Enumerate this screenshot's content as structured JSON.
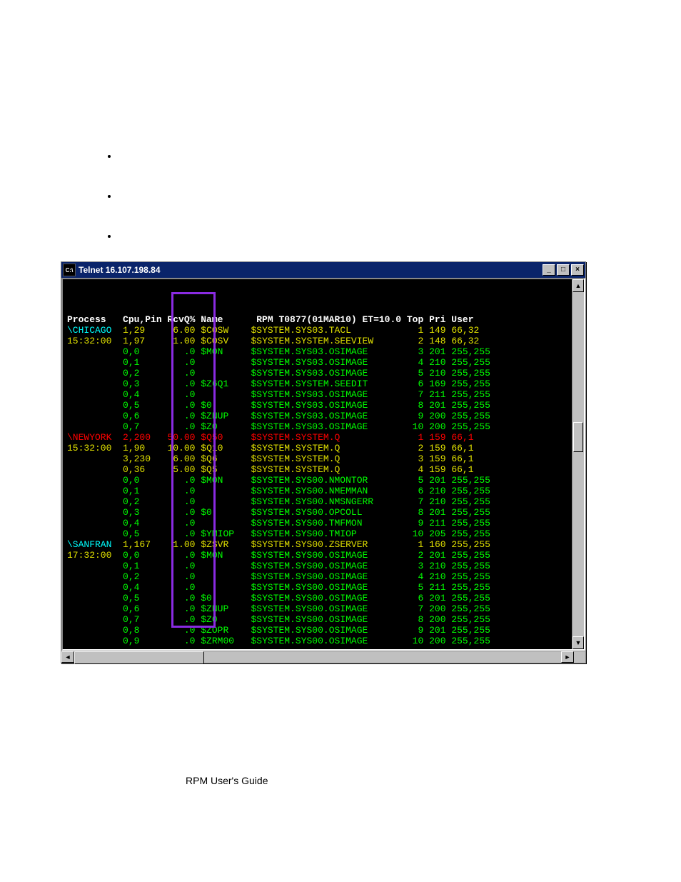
{
  "titlebar": {
    "icon_label": "C:\\",
    "title": "Telnet 16.107.198.84",
    "min_label": "_",
    "max_label": "□",
    "close_label": "×"
  },
  "header": {
    "process": "Process",
    "cpupin": "Cpu,Pin",
    "rcvq": "RcvQ%",
    "name": "Name",
    "right": "RPM T0877(01MAR10) ET=10.0 Top Pri User"
  },
  "nodes": [
    {
      "node": "\\CHICAGO",
      "time": "15:32:00",
      "node_cls": "cyan",
      "time_cls": "yel",
      "rows": [
        {
          "cpu": "1,29",
          "rcv": "6.00",
          "nm": "$COSW",
          "prog": "$SYSTEM.SYS03.TACL",
          "top": "1",
          "pri": "149",
          "user": "66,32",
          "cls": "yel"
        },
        {
          "cpu": "1,97",
          "rcv": "1.00",
          "nm": "$COSV",
          "prog": "$SYSTEM.SYSTEM.SEEVIEW",
          "top": "2",
          "pri": "148",
          "user": "66,32",
          "cls": "yel"
        },
        {
          "cpu": "0,0",
          "rcv": ".0",
          "nm": "$MON",
          "prog": "$SYSTEM.SYS03.OSIMAGE",
          "top": "3",
          "pri": "201",
          "user": "255,255",
          "cls": "grn"
        },
        {
          "cpu": "0,1",
          "rcv": ".0",
          "nm": "",
          "prog": "$SYSTEM.SYS03.OSIMAGE",
          "top": "4",
          "pri": "210",
          "user": "255,255",
          "cls": "grn"
        },
        {
          "cpu": "0,2",
          "rcv": ".0",
          "nm": "",
          "prog": "$SYSTEM.SYS03.OSIMAGE",
          "top": "5",
          "pri": "210",
          "user": "255,255",
          "cls": "grn"
        },
        {
          "cpu": "0,3",
          "rcv": ".0",
          "nm": "$Z6Q1",
          "prog": "$SYSTEM.SYSTEM.SEEDIT",
          "top": "6",
          "pri": "169",
          "user": "255,255",
          "cls": "grn"
        },
        {
          "cpu": "0,4",
          "rcv": ".0",
          "nm": "",
          "prog": "$SYSTEM.SYS03.OSIMAGE",
          "top": "7",
          "pri": "211",
          "user": "255,255",
          "cls": "grn"
        },
        {
          "cpu": "0,5",
          "rcv": ".0",
          "nm": "$0",
          "prog": "$SYSTEM.SYS03.OSIMAGE",
          "top": "8",
          "pri": "201",
          "user": "255,255",
          "cls": "grn"
        },
        {
          "cpu": "0,6",
          "rcv": ".0",
          "nm": "$ZNUP",
          "prog": "$SYSTEM.SYS03.OSIMAGE",
          "top": "9",
          "pri": "200",
          "user": "255,255",
          "cls": "grn"
        },
        {
          "cpu": "0,7",
          "rcv": ".0",
          "nm": "$Z0",
          "prog": "$SYSTEM.SYS03.OSIMAGE",
          "top": "10",
          "pri": "200",
          "user": "255,255",
          "cls": "grn"
        }
      ]
    },
    {
      "node": "\\NEWYORK",
      "time": "15:32:00",
      "node_cls": "red",
      "time_cls": "yel",
      "rows": [
        {
          "cpu": "2,200",
          "rcv": "50.00",
          "nm": "$Q50",
          "prog": "$SYSTEM.SYSTEM.Q",
          "top": "1",
          "pri": "159",
          "user": "66,1",
          "cls": "red"
        },
        {
          "cpu": "1,90",
          "rcv": "10.00",
          "nm": "$Q10",
          "prog": "$SYSTEM.SYSTEM.Q",
          "top": "2",
          "pri": "159",
          "user": "66,1",
          "cls": "yel"
        },
        {
          "cpu": "3,230",
          "rcv": "6.00",
          "nm": "$Q6",
          "prog": "$SYSTEM.SYSTEM.Q",
          "top": "3",
          "pri": "159",
          "user": "66,1",
          "cls": "yel"
        },
        {
          "cpu": "0,36",
          "rcv": "5.00",
          "nm": "$Q5",
          "prog": "$SYSTEM.SYSTEM.Q",
          "top": "4",
          "pri": "159",
          "user": "66,1",
          "cls": "yel"
        },
        {
          "cpu": "0,0",
          "rcv": ".0",
          "nm": "$MON",
          "prog": "$SYSTEM.SYS00.NMONTOR",
          "top": "5",
          "pri": "201",
          "user": "255,255",
          "cls": "grn"
        },
        {
          "cpu": "0,1",
          "rcv": ".0",
          "nm": "",
          "prog": "$SYSTEM.SYS00.NMEMMAN",
          "top": "6",
          "pri": "210",
          "user": "255,255",
          "cls": "grn"
        },
        {
          "cpu": "0,2",
          "rcv": ".0",
          "nm": "",
          "prog": "$SYSTEM.SYS00.NMSNGERR",
          "top": "7",
          "pri": "210",
          "user": "255,255",
          "cls": "grn"
        },
        {
          "cpu": "0,3",
          "rcv": ".0",
          "nm": "$0",
          "prog": "$SYSTEM.SYS00.OPCOLL",
          "top": "8",
          "pri": "201",
          "user": "255,255",
          "cls": "grn"
        },
        {
          "cpu": "0,4",
          "rcv": ".0",
          "nm": "",
          "prog": "$SYSTEM.SYS00.TMFMON",
          "top": "9",
          "pri": "211",
          "user": "255,255",
          "cls": "grn"
        },
        {
          "cpu": "0,5",
          "rcv": ".0",
          "nm": "$YMIOP",
          "prog": "$SYSTEM.SYS00.TMIOP",
          "top": "10",
          "pri": "205",
          "user": "255,255",
          "cls": "grn"
        }
      ]
    },
    {
      "node": "\\SANFRAN",
      "time": "17:32:00",
      "node_cls": "cyan",
      "time_cls": "yel",
      "rows": [
        {
          "cpu": "1,167",
          "rcv": "1.00",
          "nm": "$ZSVR",
          "prog": "$SYSTEM.SYS00.ZSERVER",
          "top": "1",
          "pri": "160",
          "user": "255,255",
          "cls": "yel"
        },
        {
          "cpu": "0,0",
          "rcv": ".0",
          "nm": "$MON",
          "prog": "$SYSTEM.SYS00.OSIMAGE",
          "top": "2",
          "pri": "201",
          "user": "255,255",
          "cls": "grn"
        },
        {
          "cpu": "0,1",
          "rcv": ".0",
          "nm": "",
          "prog": "$SYSTEM.SYS00.OSIMAGE",
          "top": "3",
          "pri": "210",
          "user": "255,255",
          "cls": "grn"
        },
        {
          "cpu": "0,2",
          "rcv": ".0",
          "nm": "",
          "prog": "$SYSTEM.SYS00.OSIMAGE",
          "top": "4",
          "pri": "210",
          "user": "255,255",
          "cls": "grn"
        },
        {
          "cpu": "0,4",
          "rcv": ".0",
          "nm": "",
          "prog": "$SYSTEM.SYS00.OSIMAGE",
          "top": "5",
          "pri": "211",
          "user": "255,255",
          "cls": "grn"
        },
        {
          "cpu": "0,5",
          "rcv": ".0",
          "nm": "$0",
          "prog": "$SYSTEM.SYS00.OSIMAGE",
          "top": "6",
          "pri": "201",
          "user": "255,255",
          "cls": "grn"
        },
        {
          "cpu": "0,6",
          "rcv": ".0",
          "nm": "$ZNUP",
          "prog": "$SYSTEM.SYS00.OSIMAGE",
          "top": "7",
          "pri": "200",
          "user": "255,255",
          "cls": "grn"
        },
        {
          "cpu": "0,7",
          "rcv": ".0",
          "nm": "$Z0",
          "prog": "$SYSTEM.SYS00.OSIMAGE",
          "top": "8",
          "pri": "200",
          "user": "255,255",
          "cls": "grn"
        },
        {
          "cpu": "0,8",
          "rcv": ".0",
          "nm": "$ZOPR",
          "prog": "$SYSTEM.SYS00.OSIMAGE",
          "top": "9",
          "pri": "201",
          "user": "255,255",
          "cls": "grn"
        },
        {
          "cpu": "0,9",
          "rcv": ".0",
          "nm": "$ZRM00",
          "prog": "$SYSTEM.SYS00.OSIMAGE",
          "top": "10",
          "pri": "200",
          "user": "255,255",
          "cls": "grn"
        }
      ]
    }
  ],
  "footer": "RPM User's Guide"
}
